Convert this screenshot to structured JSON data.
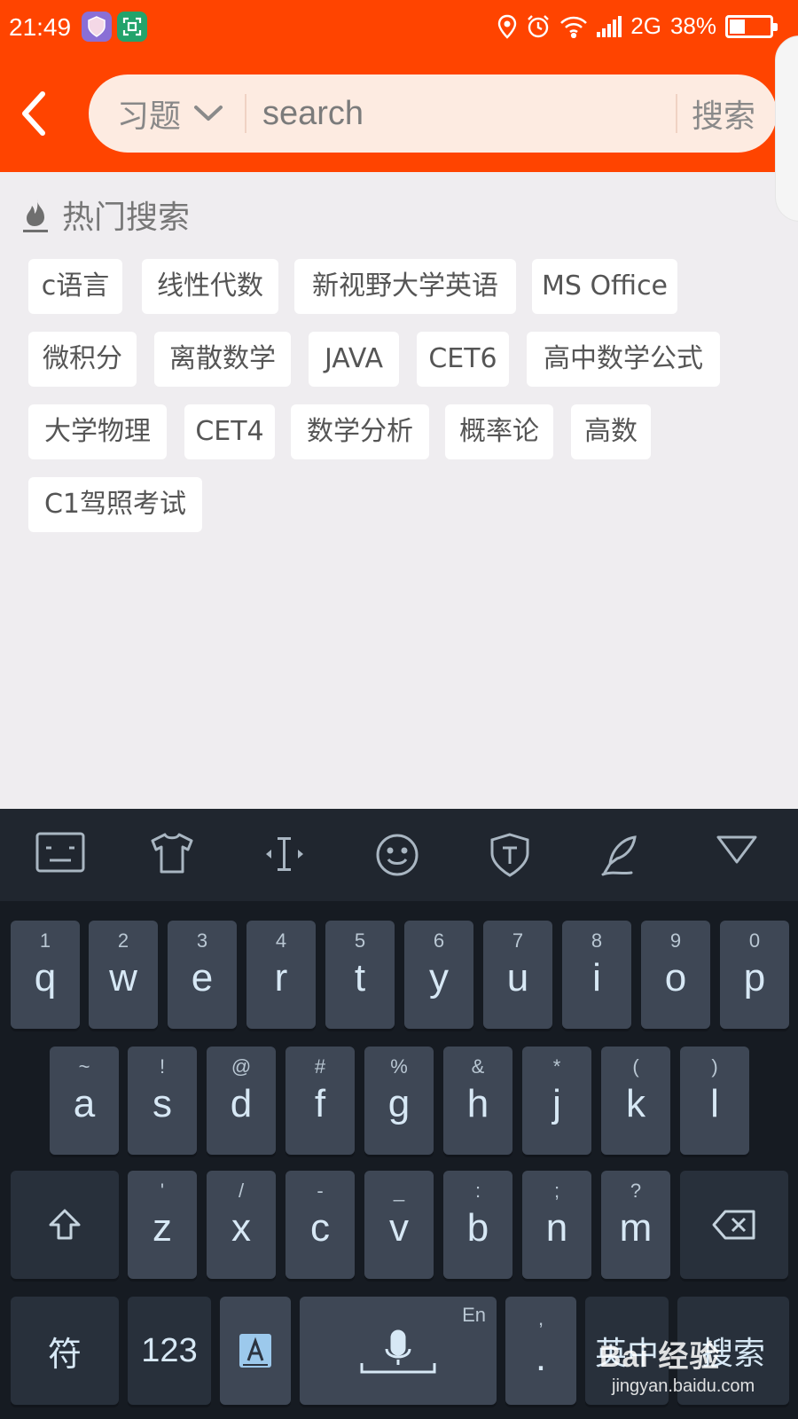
{
  "status": {
    "time": "21:49",
    "network": "2G",
    "battery_text": "38%",
    "battery_level": 0.38
  },
  "header": {
    "scope": "习题",
    "search_placeholder": "search",
    "search_button": "搜索"
  },
  "hot": {
    "title": "热门搜索",
    "tags": [
      "c语言",
      "线性代数",
      "新视野大学英语",
      "MS Office",
      "微积分",
      "离散数学",
      "JAVA",
      "CET6",
      "高中数学公式",
      "大学物理",
      "CET4",
      "数学分析",
      "概率论",
      "高数",
      "C1驾照考试"
    ]
  },
  "keyboard": {
    "row1": [
      {
        "main": "q",
        "sub": "1"
      },
      {
        "main": "w",
        "sub": "2"
      },
      {
        "main": "e",
        "sub": "3"
      },
      {
        "main": "r",
        "sub": "4"
      },
      {
        "main": "t",
        "sub": "5"
      },
      {
        "main": "y",
        "sub": "6"
      },
      {
        "main": "u",
        "sub": "7"
      },
      {
        "main": "i",
        "sub": "8"
      },
      {
        "main": "o",
        "sub": "9"
      },
      {
        "main": "p",
        "sub": "0"
      }
    ],
    "row2": [
      {
        "main": "a",
        "sub": "~"
      },
      {
        "main": "s",
        "sub": "!"
      },
      {
        "main": "d",
        "sub": "@"
      },
      {
        "main": "f",
        "sub": "#"
      },
      {
        "main": "g",
        "sub": "%"
      },
      {
        "main": "h",
        "sub": "&"
      },
      {
        "main": "j",
        "sub": "*"
      },
      {
        "main": "k",
        "sub": "("
      },
      {
        "main": "l",
        "sub": ")"
      }
    ],
    "row3": [
      {
        "main": "z",
        "sub": "'"
      },
      {
        "main": "x",
        "sub": "/"
      },
      {
        "main": "c",
        "sub": "-"
      },
      {
        "main": "v",
        "sub": "_"
      },
      {
        "main": "b",
        "sub": ":"
      },
      {
        "main": "n",
        "sub": ";"
      },
      {
        "main": "m",
        "sub": "?"
      }
    ],
    "symbols_key": "符",
    "numbers_key": "123",
    "lang_hint": "En",
    "punct_main": ".",
    "punct_sub": ",",
    "switch_key": "英中",
    "search_key": "搜索"
  },
  "watermark": {
    "brand": "Bai 经验",
    "url": "jingyan.baidu.com"
  }
}
